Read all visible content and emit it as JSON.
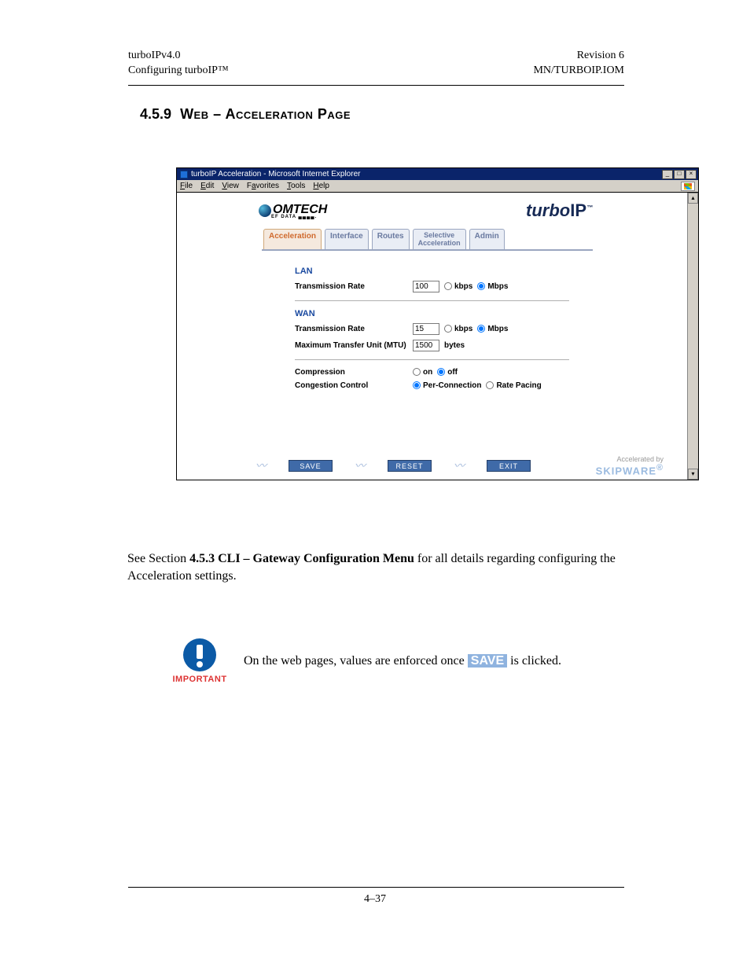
{
  "doc_header": {
    "left1": "turboIPv4.0",
    "left2": "Configuring turboIP™",
    "right1": "Revision 6",
    "right2": "MN/TURBOIP.IOM"
  },
  "section": {
    "number": "4.5.9",
    "title": "Web – Acceleration Page"
  },
  "browser": {
    "title": "turboIP Acceleration - Microsoft Internet Explorer",
    "menu": {
      "file": "File",
      "edit": "Edit",
      "view": "View",
      "favorites": "Favorites",
      "tools": "Tools",
      "help": "Help"
    },
    "logos": {
      "comtech_text": "OMTECH",
      "comtech_sub": "EF DATA ▄▄▄▄.",
      "turbo": "turbo",
      "turbo_ip": "IP",
      "turbo_tm": "™"
    },
    "tabs": {
      "acceleration": "Acceleration",
      "interface": "Interface",
      "routes": "Routes",
      "selective1": "Selective",
      "selective2": "Acceleration",
      "admin": "Admin"
    },
    "lan": {
      "heading": "LAN",
      "rate_label": "Transmission Rate",
      "rate_value": "100",
      "kbps": "kbps",
      "mbps": "Mbps"
    },
    "wan": {
      "heading": "WAN",
      "rate_label": "Transmission Rate",
      "rate_value": "15",
      "kbps": "kbps",
      "mbps": "Mbps",
      "mtu_label": "Maximum Transfer Unit (MTU)",
      "mtu_value": "1500",
      "bytes": "bytes"
    },
    "options": {
      "compression_label": "Compression",
      "on": "on",
      "off": "off",
      "congestion_label": "Congestion Control",
      "per_conn": "Per-Connection",
      "rate_pacing": "Rate Pacing"
    },
    "buttons": {
      "save": "SAVE",
      "reset": "RESET",
      "exit": "EXIT"
    },
    "skip": {
      "accel": "Accelerated by",
      "brand": "SKIPWARE",
      "reg": "®"
    }
  },
  "body": {
    "para_pre": "See Section ",
    "para_bold": "4.5.3 CLI – Gateway Configuration Menu",
    "para_post": " for all details regarding configuring the Acceleration settings."
  },
  "important": {
    "label": "IMPORTANT",
    "text_pre": "On the web pages, values are enforced once ",
    "save": "SAVE",
    "text_post": " is clicked."
  },
  "footer": {
    "page": "4–37"
  }
}
